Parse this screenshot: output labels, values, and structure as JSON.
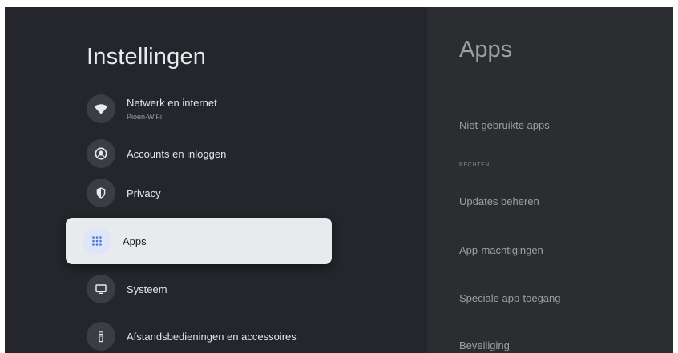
{
  "settings": {
    "title": "Instellingen",
    "items": [
      {
        "label": "Netwerk en internet",
        "sublabel": "Pioen-WiFi",
        "icon": "wifi-icon"
      },
      {
        "label": "Accounts en inloggen",
        "icon": "account-icon"
      },
      {
        "label": "Privacy",
        "icon": "shield-icon"
      },
      {
        "label": "Apps",
        "icon": "apps-grid-icon",
        "selected": true
      },
      {
        "label": "Systeem",
        "icon": "monitor-icon"
      },
      {
        "label": "Afstandsbedieningen en accessoires",
        "icon": "remote-icon"
      }
    ]
  },
  "apps_panel": {
    "title": "Apps",
    "unused_apps": "Niet-gebruikte apps",
    "section_label": "RECHTEN",
    "manage_updates": "Updates beheren",
    "app_permissions": "App-machtigingen",
    "special_access": "Speciale app-toegang",
    "security": "Beveiliging"
  },
  "colors": {
    "background": "#24262b",
    "right_panel": "#2b2d31",
    "selected_item": "#e8eaed",
    "icon_circle": "#3a3d44"
  }
}
